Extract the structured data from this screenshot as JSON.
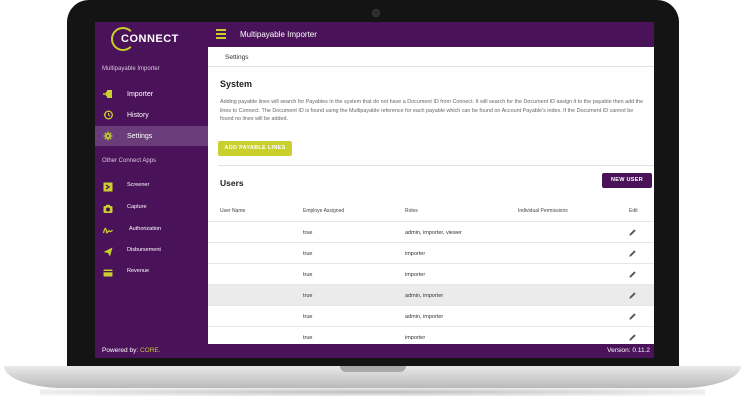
{
  "app": {
    "logo_text": "CONNECT",
    "title": "Multipayable Importer"
  },
  "sidebar": {
    "heading": "Multipayable Importer",
    "items": [
      {
        "label": "Importer",
        "icon": "import-icon"
      },
      {
        "label": "History",
        "icon": "history-icon"
      },
      {
        "label": "Settings",
        "icon": "gear-icon",
        "active": true
      }
    ],
    "apps_heading": "Other Connect Apps",
    "apps": [
      {
        "label": "Screener",
        "icon": "screener-icon"
      },
      {
        "label": "Capture",
        "icon": "camera-icon"
      },
      {
        "label": "Authorization",
        "icon": "signature-icon"
      },
      {
        "label": "Disbursement",
        "icon": "send-icon"
      },
      {
        "label": "Revenue",
        "icon": "card-icon"
      }
    ]
  },
  "tabs": [
    {
      "label": "Settings"
    }
  ],
  "system": {
    "title": "System",
    "description": "Adding payable lines will search for Payables in the system that do not have a Document ID from Connect. It will search for the Document ID assign it to the payable then add the lines to Connect. The Document ID is found using the Multipayable reference for each payable which can be found on Account Payable's index. If the Document ID cannot be found no lines will be added.",
    "add_button": "ADD PAYABLE LINES"
  },
  "users": {
    "title": "Users",
    "new_button": "NEW USER",
    "columns": [
      "User Name",
      "Employe Assigned",
      "Roles",
      "Individual Permissions",
      "Edit"
    ],
    "rows": [
      {
        "user": "",
        "assigned": "true",
        "roles": "admin, importer, viewer",
        "permissions": ""
      },
      {
        "user": "",
        "assigned": "true",
        "roles": "importer",
        "permissions": ""
      },
      {
        "user": "",
        "assigned": "true",
        "roles": "importer",
        "permissions": ""
      },
      {
        "user": "",
        "assigned": "true",
        "roles": "admin, importer",
        "permissions": "",
        "highlighted": true
      },
      {
        "user": "",
        "assigned": "true",
        "roles": "admin, importer",
        "permissions": ""
      },
      {
        "user": "",
        "assigned": "true",
        "roles": "importer",
        "permissions": ""
      }
    ]
  },
  "footer": {
    "powered_prefix": "Powered by: ",
    "powered_brand": "CORE.",
    "version": "Version: 0.11.2"
  },
  "colors": {
    "primary": "#4a1259",
    "accent": "#c9cf2c",
    "active_item": "#6a3c79"
  }
}
